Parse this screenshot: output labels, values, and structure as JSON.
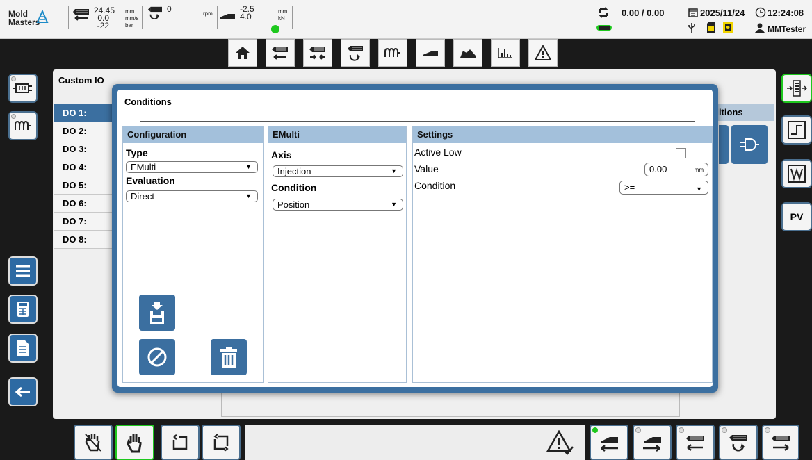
{
  "brand": {
    "line1": "Mold",
    "line2": "Masters"
  },
  "status": {
    "injection_values": [
      "24.45",
      "0.0",
      "-22"
    ],
    "injection_units": [
      "mm",
      "mm/s",
      "bar"
    ],
    "screw_value": "0",
    "screw_unit": "rpm",
    "clamp_values": [
      "-2.5",
      "4.0"
    ],
    "clamp_units": [
      "mm",
      "kN"
    ],
    "cycle": "0.00 / 0.00",
    "date": "2025/11/24",
    "time": "12:24:08",
    "user": "MMTester"
  },
  "main": {
    "title": "Custom IO",
    "outputs": [
      "DO 1:",
      "DO 2:",
      "DO 3:",
      "DO 4:",
      "DO 5:",
      "DO 6:",
      "DO 7:",
      "DO 8:"
    ],
    "conditions_header": "ditions"
  },
  "modal": {
    "title": "Conditions",
    "configuration": {
      "header": "Configuration",
      "type_label": "Type",
      "type_value": "EMulti",
      "evaluation_label": "Evaluation",
      "evaluation_value": "Direct"
    },
    "emulti": {
      "header": "EMulti",
      "axis_label": "Axis",
      "axis_value": "Injection",
      "condition_label": "Condition",
      "condition_value": "Position"
    },
    "settings": {
      "header": "Settings",
      "active_low_label": "Active Low",
      "active_low_checked": false,
      "value_label": "Value",
      "value": "0.00",
      "value_unit": "mm",
      "condition_label": "Condition",
      "condition_value": ">="
    }
  },
  "right_rail": {
    "pv_label": "PV"
  },
  "colors": {
    "accent": "#3b6fa0",
    "header": "#a3c0db",
    "active": "#1ec81e"
  }
}
